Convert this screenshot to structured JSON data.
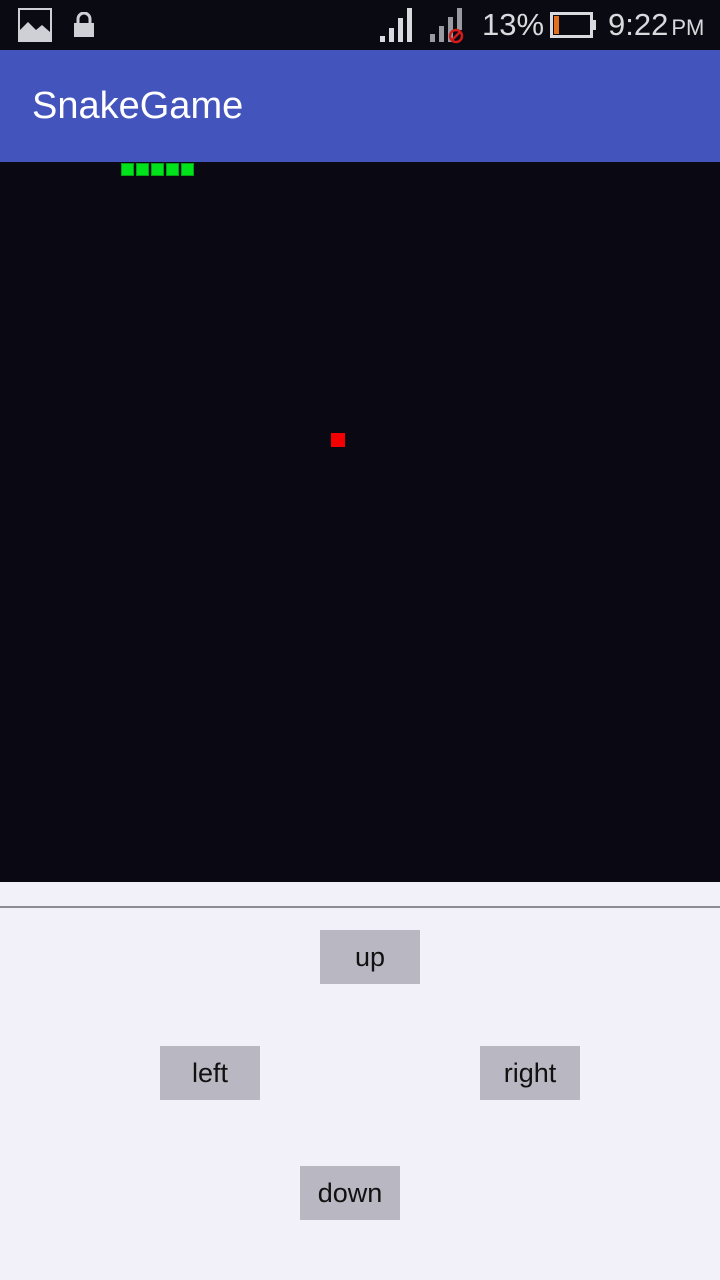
{
  "status_bar": {
    "icons": {
      "gallery": "gallery-icon",
      "lock": "lock-icon",
      "signal_1": "cell-signal-icon",
      "signal_2": "cell-signal-no-service-icon",
      "battery": "battery-low-icon"
    },
    "battery_percent": "13%",
    "time": "9:22",
    "ampm": "PM",
    "battery_level": 0.13
  },
  "app_bar": {
    "title": "SnakeGame",
    "color": "#4354bd"
  },
  "game": {
    "grid_columns": 48,
    "grid_rows": 48,
    "snake": [
      {
        "col": 8,
        "row": 0
      },
      {
        "col": 9,
        "row": 0
      },
      {
        "col": 10,
        "row": 0
      },
      {
        "col": 11,
        "row": 0
      },
      {
        "col": 12,
        "row": 0
      }
    ],
    "food": {
      "col": 22,
      "row": 18
    },
    "colors": {
      "background": "#0a0913",
      "snake": "#00e21c",
      "food": "#f40000"
    }
  },
  "controls": {
    "up_label": "up",
    "left_label": "left",
    "right_label": "right",
    "down_label": "down"
  }
}
